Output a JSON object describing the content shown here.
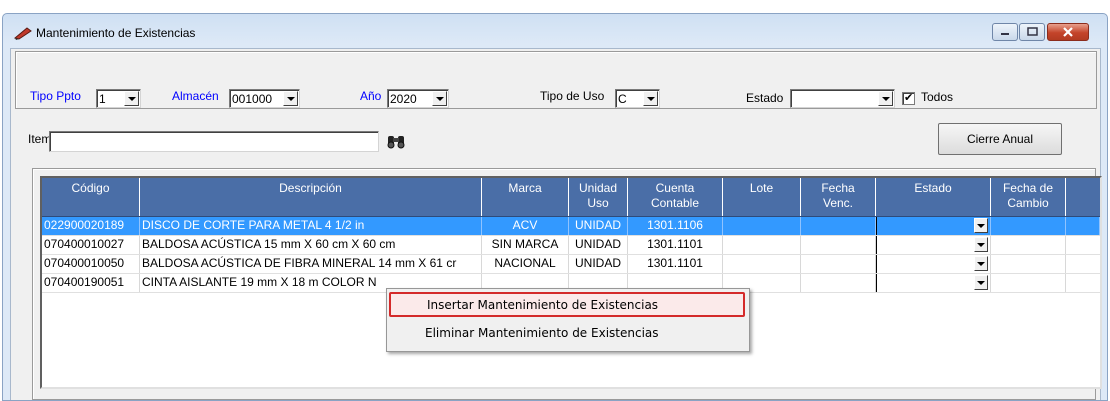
{
  "window": {
    "title": "Mantenimiento de Existencias"
  },
  "filters": {
    "tipo_ppto_label": "Tipo Ppto",
    "tipo_ppto_value": "1",
    "almacen_label": "Almacén",
    "almacen_value": "001000",
    "anio_label": "Año",
    "anio_value": "2020",
    "tipo_uso_label": "Tipo de Uso",
    "tipo_uso_value": "C",
    "estado_label": "Estado",
    "estado_value": "",
    "todos_label": "Todos",
    "todos_checked": true
  },
  "search": {
    "item_label": "Item",
    "item_value": ""
  },
  "actions": {
    "cierre_label": "Cierre Anual"
  },
  "grid": {
    "columns": [
      "Código",
      "Descripción",
      "Marca",
      "Unidad Uso",
      "Cuenta Contable",
      "Lote",
      "Fecha Venc.",
      "Estado",
      "Fecha de Cambio"
    ],
    "header_lines": {
      "unidad_1": "Unidad",
      "unidad_2": "Uso",
      "cuenta_1": "Cuenta",
      "cuenta_2": "Contable",
      "fecha_1": "Fecha",
      "fecha_2": "Venc.",
      "cambio_1": "Fecha de",
      "cambio_2": "Cambio"
    },
    "rows": [
      {
        "codigo": "022900020189",
        "descripcion": "DISCO DE CORTE PARA METAL 4 1/2 in",
        "marca": "ACV",
        "unidad": "UNIDAD",
        "cuenta": "1301.1106",
        "lote": "",
        "fecha_venc": "",
        "estado": "",
        "fecha_cambio": ""
      },
      {
        "codigo": "070400010027",
        "descripcion": "BALDOSA ACÚSTICA 15 mm X 60 cm X 60 cm",
        "marca": "SIN MARCA",
        "unidad": "UNIDAD",
        "cuenta": "1301.1101",
        "lote": "",
        "fecha_venc": "",
        "estado": "",
        "fecha_cambio": ""
      },
      {
        "codigo": "070400010050",
        "descripcion": "BALDOSA ACÚSTICA DE FIBRA MINERAL 14 mm X 61 cr",
        "marca": "NACIONAL",
        "unidad": "UNIDAD",
        "cuenta": "1301.1101",
        "lote": "",
        "fecha_venc": "",
        "estado": "",
        "fecha_cambio": ""
      },
      {
        "codigo": "070400190051",
        "descripcion": "CINTA AISLANTE 19 mm X 18 m COLOR N",
        "marca": "",
        "unidad": "",
        "cuenta": "",
        "lote": "",
        "fecha_venc": "",
        "estado": "",
        "fecha_cambio": ""
      }
    ]
  },
  "context_menu": {
    "items": [
      "Insertar Mantenimiento de Existencias",
      "Eliminar Mantenimiento de Existencias"
    ]
  },
  "colors": {
    "header": "#4a6ea7",
    "selection": "#3399ff",
    "highlight_border": "#d42a2a"
  }
}
